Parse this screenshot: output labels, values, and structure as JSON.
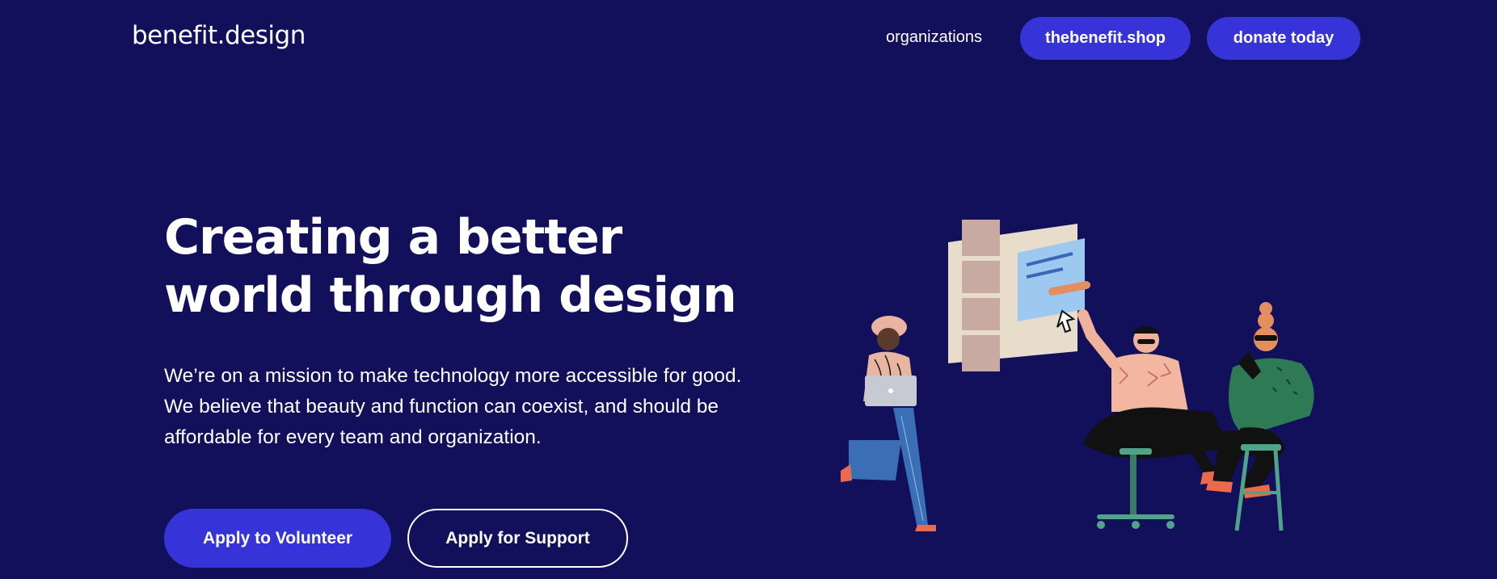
{
  "header": {
    "logo": "benefit.design",
    "nav": {
      "organizations": "organizations",
      "shop": "thebenefit.shop",
      "donate": "donate today"
    }
  },
  "hero": {
    "title_line1": "Creating a better",
    "title_line2": "world through design",
    "description": "We’re on a mission to make technology more accessible for good. We believe that beauty and function can coexist, and should be affordable for every team and organization.",
    "buttons": {
      "volunteer": "Apply to Volunteer",
      "support": "Apply for Support"
    }
  },
  "colors": {
    "background": "#12105b",
    "accent": "#3634d8",
    "text": "#ffffff"
  }
}
